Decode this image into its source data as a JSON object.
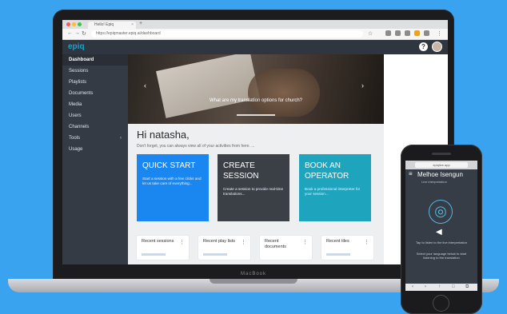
{
  "colors": {
    "background": "#3aa3ef",
    "header": "#2f3640",
    "sidebar": "#353b45",
    "quick_start": "#1a87f0",
    "create_session": "#3b4047",
    "book_operator": "#1fa4be"
  },
  "browser": {
    "tab_title": "Hello! Epiq",
    "url": "https://epiqmaster.epiq.ai/dashboard",
    "icons": [
      "back-icon",
      "forward-icon",
      "reload-icon",
      "star-icon",
      "extension-icon"
    ]
  },
  "app": {
    "logo": "epiq",
    "help_label": "?"
  },
  "sidebar": {
    "items": [
      {
        "label": "Dashboard",
        "active": true
      },
      {
        "label": "Sessions"
      },
      {
        "label": "Playlists"
      },
      {
        "label": "Documents"
      },
      {
        "label": "Media"
      },
      {
        "label": "Users"
      },
      {
        "label": "Channels"
      },
      {
        "label": "Tools",
        "chevron": "‹"
      },
      {
        "label": "Usage"
      }
    ]
  },
  "hero": {
    "caption": "What are my translation options for church?",
    "prev": "‹",
    "next": "›"
  },
  "main": {
    "greeting": "Hi natasha,",
    "subtext": "Don't forget, you can always view all of your activities from here. ...",
    "cards": [
      {
        "title": "QUICK START",
        "desc": "Start a session with a few clicks and let us take care of everything..."
      },
      {
        "title": "CREATE SESSION",
        "desc": "Create a session to provide real-time translations..."
      },
      {
        "title": "BOOK AN OPERATOR",
        "desc": "Book a professional interpreter for your session..."
      }
    ],
    "recent": [
      {
        "label": "Recent sessions"
      },
      {
        "label": "Recent play lists"
      },
      {
        "label": "Recent documents"
      },
      {
        "label": "Recent tiles"
      }
    ]
  },
  "phone": {
    "url": "epiqlive.app",
    "title": "Melhoe Isengun",
    "subtitle": "Live interpretation",
    "text1": "Tap to listen to the live interpretation",
    "text2": "Select your language below to start listening to the translation"
  },
  "laptop_brand": "MacBook"
}
